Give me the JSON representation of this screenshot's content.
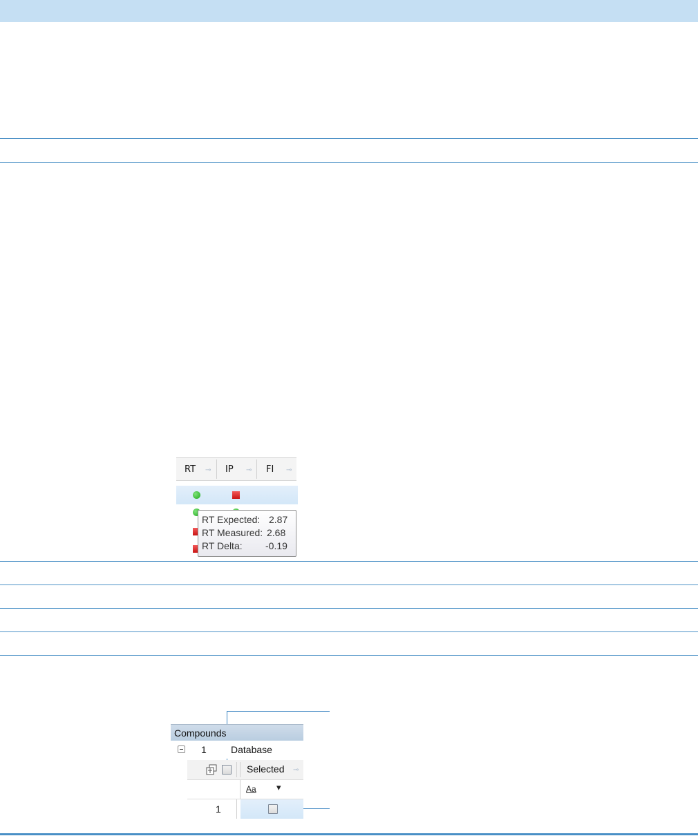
{
  "figure1": {
    "columns": [
      {
        "label": "RT",
        "pin": "⊸"
      },
      {
        "label": "IP",
        "pin": "⊸"
      },
      {
        "label": "FI",
        "pin": "⊸"
      }
    ],
    "tooltip": {
      "rows": [
        {
          "key": "RT Expected:",
          "value": "2.87"
        },
        {
          "key": "RT Measured:",
          "value": "2.68"
        },
        {
          "key": "RT Delta:",
          "value": "-0.19"
        }
      ]
    },
    "status_colors": {
      "pass": "#1fa81c",
      "fail": "#c91414"
    }
  },
  "figure2": {
    "panel_title": "Compounds",
    "row_number": "1",
    "row_label": "Database",
    "column_header": "Selected",
    "column_pin": "⊸",
    "filter_label": "Aa",
    "filter_arrow": "▾",
    "data_row_number": "1"
  },
  "colors": {
    "band": "#c5dff3",
    "rule": "#4a90c6",
    "selection": "#d3e7f8"
  }
}
